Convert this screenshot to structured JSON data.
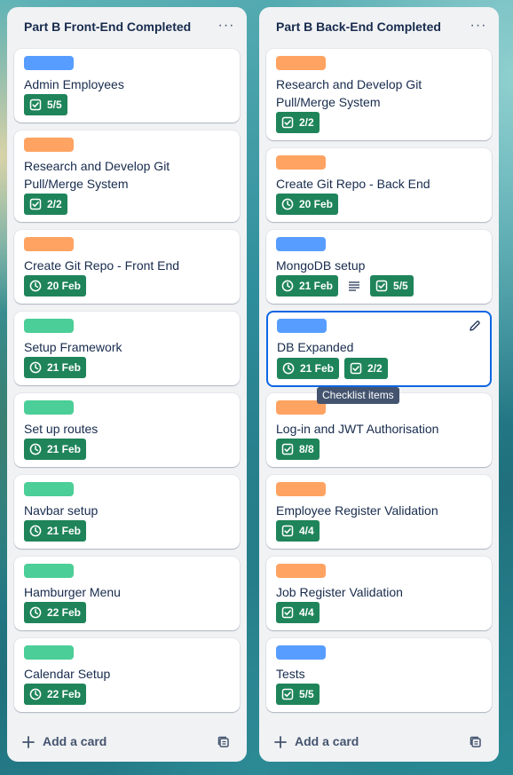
{
  "colors": {
    "blue_label": "#579dff",
    "orange_label": "#fea362",
    "green_label": "#4bce97",
    "badge_green": "#1f845a",
    "selected_border": "#0c66e4"
  },
  "lists": [
    {
      "title": "Part B Front-End Completed",
      "menu_label": "···",
      "add_label": "Add a card",
      "cards": [
        {
          "label_color": "blue",
          "title": "Admin Employees",
          "badges": [
            {
              "icon": "checklist-icon",
              "text": "5/5"
            }
          ]
        },
        {
          "label_color": "orange",
          "title": "Research and Develop Git Pull/Merge System",
          "badges": [
            {
              "icon": "checklist-icon",
              "text": "2/2"
            }
          ]
        },
        {
          "label_color": "orange",
          "title": "Create Git Repo - Front End",
          "badges": [
            {
              "icon": "clock-icon",
              "text": "20 Feb"
            }
          ]
        },
        {
          "label_color": "green",
          "title": "Setup Framework",
          "badges": [
            {
              "icon": "clock-icon",
              "text": "21 Feb"
            }
          ]
        },
        {
          "label_color": "green",
          "title": "Set up routes",
          "badges": [
            {
              "icon": "clock-icon",
              "text": "21 Feb"
            }
          ]
        },
        {
          "label_color": "green",
          "title": "Navbar setup",
          "badges": [
            {
              "icon": "clock-icon",
              "text": "21 Feb"
            }
          ]
        },
        {
          "label_color": "green",
          "title": "Hamburger Menu",
          "badges": [
            {
              "icon": "clock-icon",
              "text": "22 Feb"
            }
          ]
        },
        {
          "label_color": "green",
          "title": "Calendar Setup",
          "badges": [
            {
              "icon": "clock-icon",
              "text": "22 Feb"
            }
          ]
        }
      ]
    },
    {
      "title": "Part B Back-End Completed",
      "menu_label": "···",
      "add_label": "Add a card",
      "cards": [
        {
          "label_color": "orange",
          "title": "Research and Develop Git Pull/Merge System",
          "badges": [
            {
              "icon": "checklist-icon",
              "text": "2/2"
            }
          ]
        },
        {
          "label_color": "orange",
          "title": "Create Git Repo - Back End",
          "badges": [
            {
              "icon": "clock-icon",
              "text": "20 Feb"
            }
          ]
        },
        {
          "label_color": "blue",
          "title": "MongoDB setup",
          "badges": [
            {
              "icon": "clock-icon",
              "text": "21 Feb"
            },
            {
              "icon": "description-icon",
              "text": ""
            },
            {
              "icon": "checklist-icon",
              "text": "5/5"
            }
          ]
        },
        {
          "label_color": "blue",
          "title": "DB Expanded",
          "selected": true,
          "badges": [
            {
              "icon": "clock-icon",
              "text": "21 Feb"
            },
            {
              "icon": "checklist-icon",
              "text": "2/2"
            }
          ]
        },
        {
          "label_color": "orange",
          "title": "Log-in and JWT Authorisation",
          "badges": [
            {
              "icon": "checklist-icon",
              "text": "8/8"
            }
          ]
        },
        {
          "label_color": "orange",
          "title": "Employee Register Validation",
          "badges": [
            {
              "icon": "checklist-icon",
              "text": "4/4"
            }
          ]
        },
        {
          "label_color": "orange",
          "title": "Job Register Validation",
          "badges": [
            {
              "icon": "checklist-icon",
              "text": "4/4"
            }
          ]
        },
        {
          "label_color": "blue",
          "title": "Tests",
          "badges": [
            {
              "icon": "checklist-icon",
              "text": "5/5"
            }
          ]
        }
      ]
    }
  ],
  "tooltip": "Checklist items"
}
